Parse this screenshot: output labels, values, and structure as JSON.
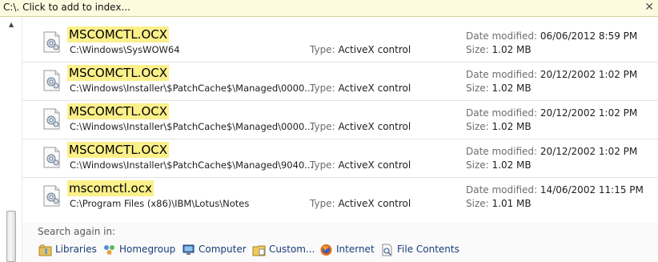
{
  "infobar": {
    "text": "C:\\. Click to add to index...",
    "close_glyph": "✕"
  },
  "scrollbar": {
    "up_glyph": "▲"
  },
  "results": [
    {
      "name": "MSCOMCTL.OCX",
      "path": "C:\\Windows\\SysWOW64",
      "type_label": "Type:",
      "type": "ActiveX control",
      "date_label": "Date modified:",
      "date": "06/06/2012 8:59 PM",
      "size_label": "Size:",
      "size": "1.02 MB",
      "icon": "activex-file-icon"
    },
    {
      "name": "MSCOMCTL.OCX",
      "path": "C:\\Windows\\Installer\\$PatchCache$\\Managed\\0000...",
      "type_label": "Type:",
      "type": "ActiveX control",
      "date_label": "Date modified:",
      "date": "20/12/2002 1:02 PM",
      "size_label": "Size:",
      "size": "1.02 MB",
      "icon": "activex-file-icon"
    },
    {
      "name": "MSCOMCTL.OCX",
      "path": "C:\\Windows\\Installer\\$PatchCache$\\Managed\\0000...",
      "type_label": "Type:",
      "type": "ActiveX control",
      "date_label": "Date modified:",
      "date": "20/12/2002 1:02 PM",
      "size_label": "Size:",
      "size": "1.02 MB",
      "icon": "activex-file-icon"
    },
    {
      "name": "MSCOMCTL.OCX",
      "path": "C:\\Windows\\Installer\\$PatchCache$\\Managed\\9040...",
      "type_label": "Type:",
      "type": "ActiveX control",
      "date_label": "Date modified:",
      "date": "20/12/2002 1:02 PM",
      "size_label": "Size:",
      "size": "1.02 MB",
      "icon": "activex-file-icon"
    },
    {
      "name": "mscomctl.ocx",
      "path": "C:\\Program Files (x86)\\IBM\\Lotus\\Notes",
      "type_label": "Type:",
      "type": "ActiveX control",
      "date_label": "Date modified:",
      "date": "14/06/2002 11:15 PM",
      "size_label": "Size:",
      "size": "1.01 MB",
      "icon": "activex-file-icon"
    }
  ],
  "search_again": {
    "label": "Search again in:",
    "links": [
      {
        "label": "Libraries",
        "icon": "libraries-icon"
      },
      {
        "label": "Homegroup",
        "icon": "homegroup-icon"
      },
      {
        "label": "Computer",
        "icon": "computer-icon"
      },
      {
        "label": "Custom...",
        "icon": "custom-folder-icon"
      },
      {
        "label": "Internet",
        "icon": "internet-icon"
      },
      {
        "label": "File Contents",
        "icon": "file-contents-icon"
      }
    ]
  },
  "colors": {
    "highlight": "#fbf08a",
    "infobar_bg": "#fdfbdf",
    "link": "#1a3e7a"
  }
}
